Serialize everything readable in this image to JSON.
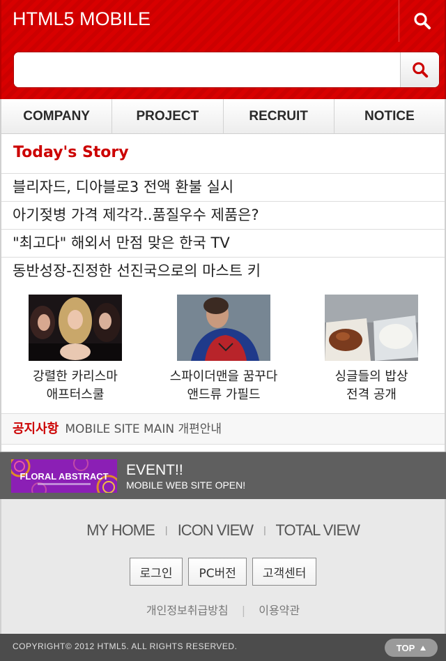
{
  "header": {
    "logo": "HTML5 MOBILE",
    "search": {
      "value": "",
      "placeholder": ""
    }
  },
  "nav": {
    "items": [
      {
        "label": "COMPANY"
      },
      {
        "label": "PROJECT"
      },
      {
        "label": "RECRUIT"
      },
      {
        "label": "NOTICE"
      }
    ]
  },
  "story": {
    "title": "Today's Story",
    "items": [
      "블리자드, 디아블로3 전액 환불 실시",
      "아기젖병 가격 제각각..품질우수 제품은?",
      "\"최고다\" 해외서 만점 맞은 한국 TV",
      "동반성장-진정한 선진국으로의 마스트 키"
    ],
    "thumbs": [
      {
        "caption_line1": "강렬한 카리스마",
        "caption_line2": "애프터스쿨",
        "image": "group-photo"
      },
      {
        "caption_line1": "스파이더맨을 꿈꾸다",
        "caption_line2": "앤드류 가필드",
        "image": "spiderman-photo"
      },
      {
        "caption_line1": "싱글들의 밥상",
        "caption_line2": "전격 공개",
        "image": "food-photo"
      }
    ]
  },
  "notice": {
    "label": "공지사항",
    "text": "MOBILE SITE MAIN 개편안내"
  },
  "event": {
    "banner_text": "FLORAL ABSTRACT",
    "title": "EVENT!!",
    "subtitle": "MOBILE WEB SITE OPEN!"
  },
  "footer": {
    "links": [
      "MY HOME",
      "ICON VIEW",
      "TOTAL VIEW"
    ],
    "separator": "|",
    "buttons": [
      "로그인",
      "PC버전",
      "고객센터"
    ],
    "policy": [
      "개인정보취급방침",
      "이용약관"
    ],
    "copyright": "COPYRIGHT© 2012 HTML5. ALL RIGHTS RESERVED.",
    "top_label": "TOP"
  },
  "colors": {
    "brand": "#cc0000",
    "event_bg": "#5f5f5f",
    "footer_bg": "#e9e9e9"
  }
}
